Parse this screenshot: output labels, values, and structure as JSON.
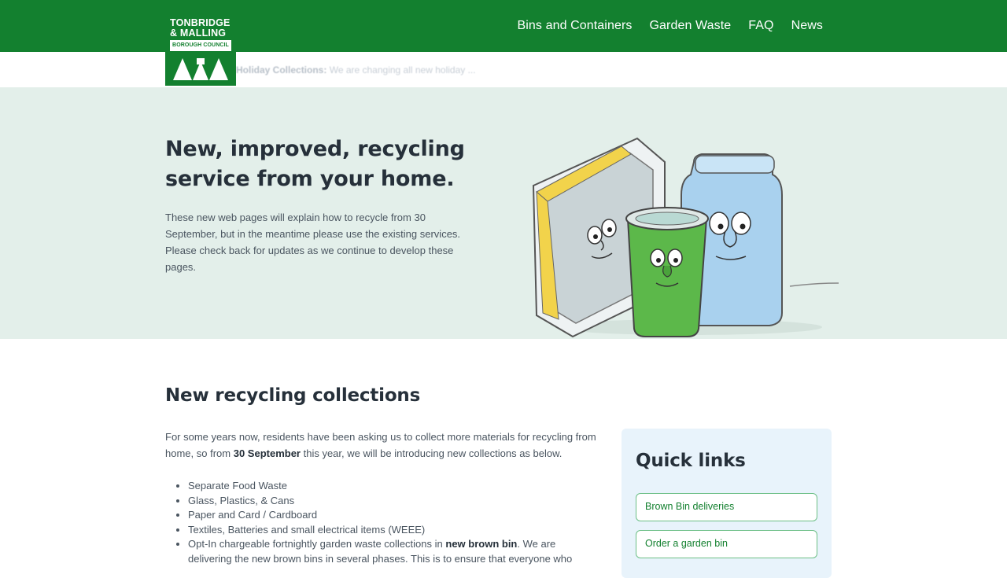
{
  "logo": {
    "line1": "TONBRIDGE",
    "line2": "& MALLING",
    "band": "BOROUGH COUNCIL"
  },
  "nav": [
    "Bins and Containers",
    "Garden Waste",
    "FAQ",
    "News"
  ],
  "alert": {
    "label": "Holiday Collections:",
    "text": "We are changing all new holiday ..."
  },
  "hero": {
    "title": "New, improved, recycling service from your home.",
    "body": "These new web pages will explain how to recycle from 30 September, but in the meantime please use the existing services. Please check back for updates as we continue to develop these pages."
  },
  "section": {
    "title": "New recycling collections",
    "intro_before": "For some years now, residents have been asking us to collect more materials for recycling from home, so from",
    "intro_bold": "30 September",
    "intro_after": "this year, we will be introducing new collections as below.",
    "items": [
      "Separate Food Waste",
      "Glass, Plastics, & Cans",
      "Paper and Card / Cardboard",
      "Textiles, Batteries and small electrical items (WEEE)"
    ],
    "item5_before": "Opt-In chargeable fortnightly garden waste collections in",
    "item5_bold": "new brown bin",
    "item5_after": ". We are delivering the new brown bins in several phases. This is to ensure that everyone who"
  },
  "quick_links": {
    "title": "Quick links",
    "links": [
      "Brown Bin deliveries",
      "Order a garden bin"
    ]
  },
  "colors": {
    "brand_green": "#13802f",
    "hero_bg": "#e3efea",
    "quick_bg": "#e8f3fb"
  }
}
